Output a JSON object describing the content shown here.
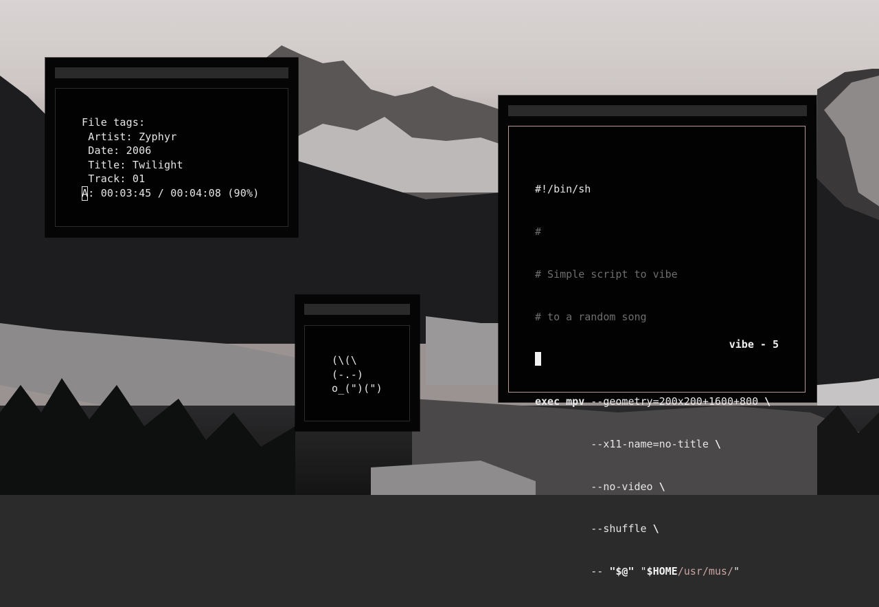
{
  "mpv_window": {
    "heading": "File tags:",
    "artist_line": " Artist: Zyphyr",
    "date_line": " Date: 2006",
    "title_line": " Title: Twilight",
    "track_line": " Track: 01",
    "status_prefix": "A",
    "status_rest": ": 00:03:45 / 00:04:08 (90%)",
    "progress_percent": 90
  },
  "bunny_window": {
    "line1": "(\\(\\",
    "line2": "(-.-)",
    "line3": "o_(\")(\")"
  },
  "editor_window": {
    "shebang": "#!/bin/sh",
    "comment_blank": "#",
    "comment1": "# Simple script to vibe",
    "comment2": "# to a random song",
    "exec": "exec",
    "mpv": "mpv",
    "arg_geometry": " --geometry=200x200+1600+800 ",
    "arg_x11": "         --x11-name=no-title ",
    "arg_novideo": "         --no-video ",
    "arg_shuffle": "         --shuffle ",
    "arg_dashdash": "         -- ",
    "quoted_args": "\"$@\"",
    "quote_open": " \"",
    "home_var": "$HOME",
    "path": "/usr/mus/",
    "quote_close": "\"",
    "backslash": "\\",
    "status": "vibe - 5"
  },
  "colors": {
    "window_bg": "#050505",
    "titlebar": "#2a2a2a",
    "editor_border": "#b89a98",
    "path_accent": "#c9a6a3",
    "comment": "#6e6e6e"
  }
}
